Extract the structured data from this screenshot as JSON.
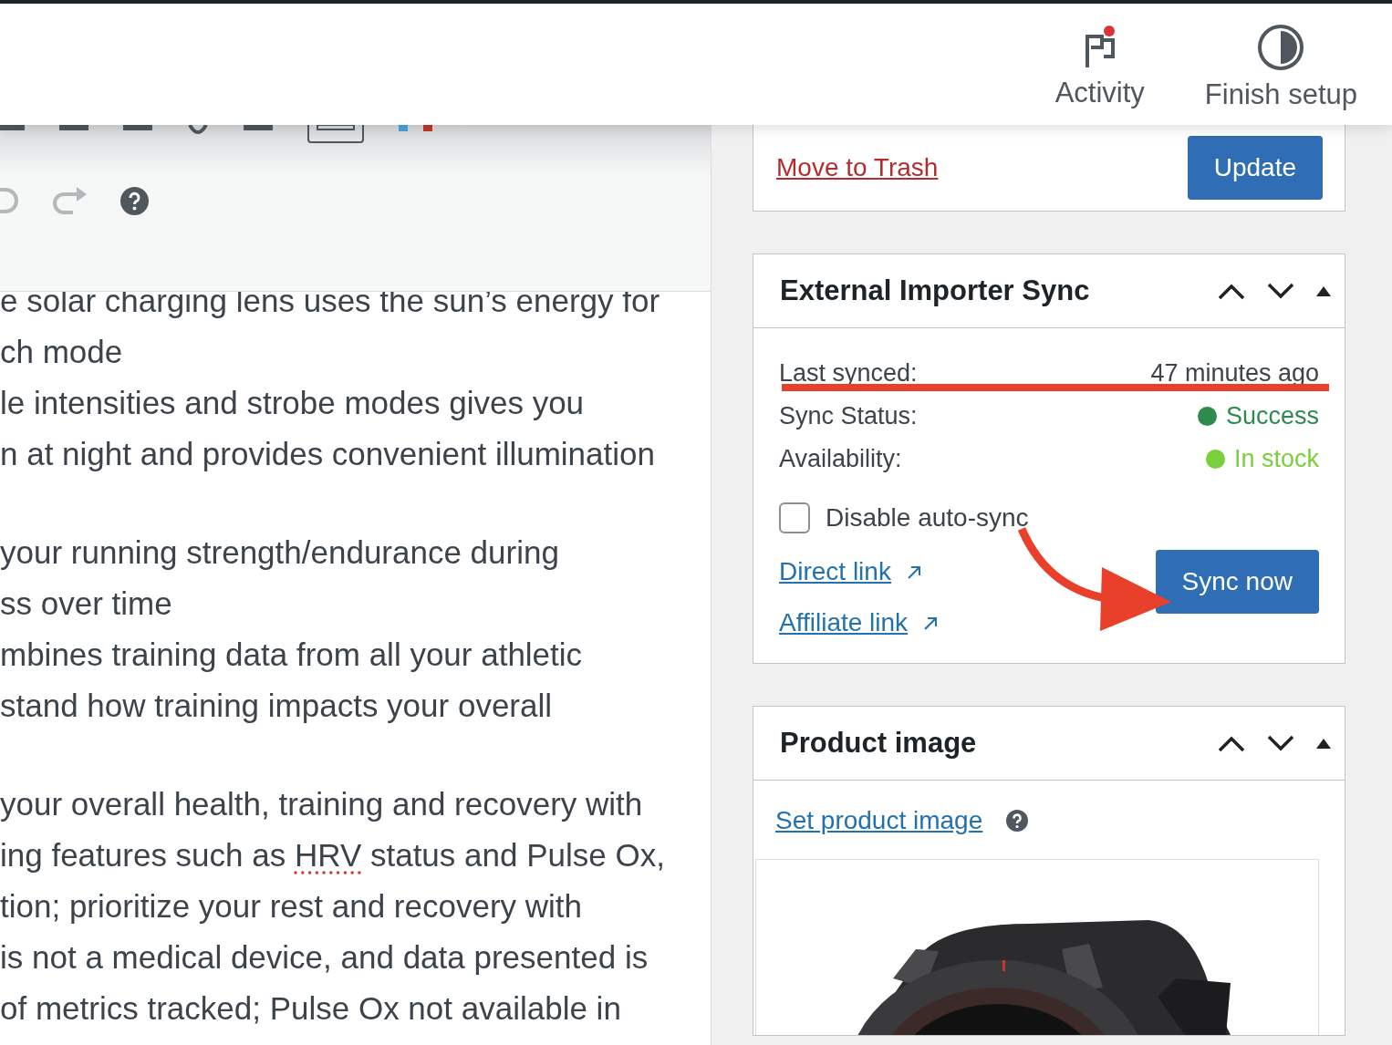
{
  "header": {
    "items": [
      {
        "label": "Activity",
        "notification": true
      },
      {
        "label": "Finish setup"
      }
    ]
  },
  "editor": {
    "paragraphs": [
      [
        {
          "segments": [
            {
              "text": "e solar charging lens uses the sun’s energy for",
              "misspelled": false
            }
          ]
        },
        {
          "segments": [
            {
              "text": "ch mode",
              "misspelled": false
            }
          ]
        },
        {
          "segments": [
            {
              "text": "le intensities and strobe modes gives you",
              "misspelled": false
            }
          ]
        },
        {
          "segments": [
            {
              "text": "n at night and provides convenient illumination",
              "misspelled": false
            }
          ]
        }
      ],
      [
        {
          "segments": [
            {
              "text": "your running strength/endurance during",
              "misspelled": false
            }
          ]
        },
        {
          "segments": [
            {
              "text": "ss over time",
              "misspelled": false
            }
          ]
        },
        {
          "segments": [
            {
              "text": "mbines training data from all your athletic",
              "misspelled": false
            }
          ]
        },
        {
          "segments": [
            {
              "text": "stand how training impacts your overall",
              "misspelled": false
            }
          ]
        }
      ],
      [
        {
          "segments": [
            {
              "text": "your overall health, training and recovery with",
              "misspelled": false
            }
          ]
        },
        {
          "segments": [
            {
              "text": "ing features such as ",
              "misspelled": false
            },
            {
              "text": "HRV",
              "misspelled": true
            },
            {
              "text": " status and Pulse Ox,",
              "misspelled": false
            }
          ]
        },
        {
          "segments": [
            {
              "text": "tion; prioritize your rest and recovery with",
              "misspelled": false
            }
          ]
        },
        {
          "segments": [
            {
              "text": "is not a medical device, and data presented is",
              "misspelled": false
            }
          ]
        },
        {
          "segments": [
            {
              "text": "of metrics tracked; Pulse Ox not available in",
              "misspelled": false
            }
          ]
        }
      ]
    ]
  },
  "publish_box": {
    "trash_link": "Move to Trash",
    "update_button": "Update"
  },
  "sync_box": {
    "title": "External Importer Sync",
    "rows": [
      {
        "label": "Last synced:",
        "value": "47 minutes ago"
      },
      {
        "label": "Sync Status:",
        "value": "Success",
        "color": "#2e8b4e"
      },
      {
        "label": "Availability:",
        "value": "In stock",
        "color": "#7ad03a"
      }
    ],
    "checkbox": {
      "label": "Disable auto-sync",
      "checked": false
    },
    "links": [
      "Direct link",
      "Affiliate link"
    ],
    "sync_button": "Sync now"
  },
  "image_box": {
    "title": "Product image",
    "set_link": "Set product image"
  }
}
